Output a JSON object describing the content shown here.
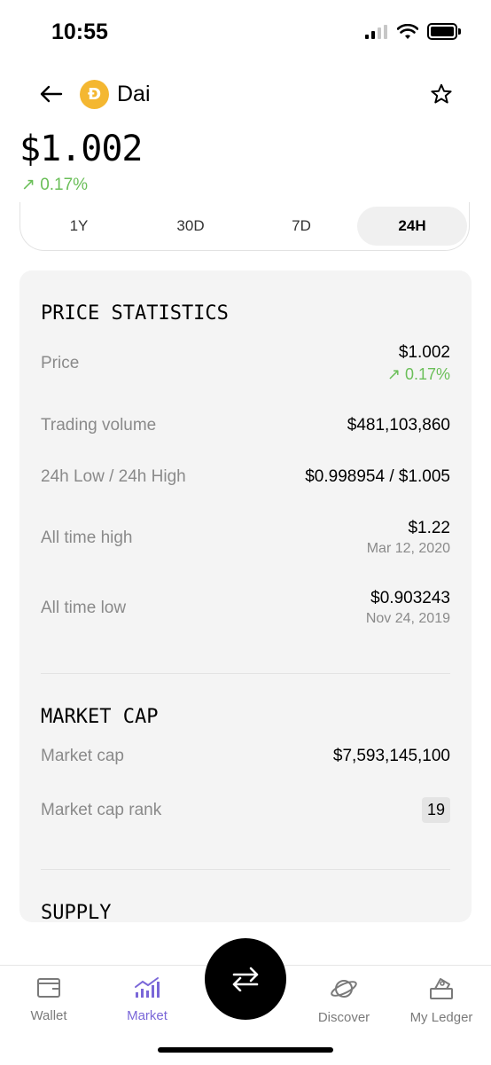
{
  "status_bar": {
    "time": "10:55"
  },
  "header": {
    "coin_name": "Dai",
    "coin_symbol_glyph": "Đ"
  },
  "price": {
    "value": "$1.002",
    "change": "↗ 0.17%"
  },
  "range_tabs": [
    {
      "label": "1Y"
    },
    {
      "label": "30D"
    },
    {
      "label": "7D"
    },
    {
      "label": "24H",
      "active": true
    }
  ],
  "price_statistics": {
    "title": "PRICE STATISTICS",
    "price_label": "Price",
    "price_value": "$1.002",
    "price_change": "↗ 0.17%",
    "volume_label": "Trading volume",
    "volume_value": "$481,103,860",
    "range_label": "24h Low / 24h High",
    "range_value": "$0.998954 / $1.005",
    "ath_label": "All time high",
    "ath_value": "$1.22",
    "ath_date": "Mar 12, 2020",
    "atl_label": "All time low",
    "atl_value": "$0.903243",
    "atl_date": "Nov 24, 2019"
  },
  "market_cap": {
    "title": "MARKET CAP",
    "cap_label": "Market cap",
    "cap_value": "$7,593,145,100",
    "rank_label": "Market cap rank",
    "rank_value": "19"
  },
  "supply": {
    "title": "SUPPLY"
  },
  "bottom_nav": {
    "wallet": "Wallet",
    "market": "Market",
    "discover": "Discover",
    "my_ledger": "My Ledger"
  },
  "colors": {
    "accent_green": "#6bbf59",
    "coin_yellow": "#f4b731",
    "nav_active": "#7a67d8"
  }
}
